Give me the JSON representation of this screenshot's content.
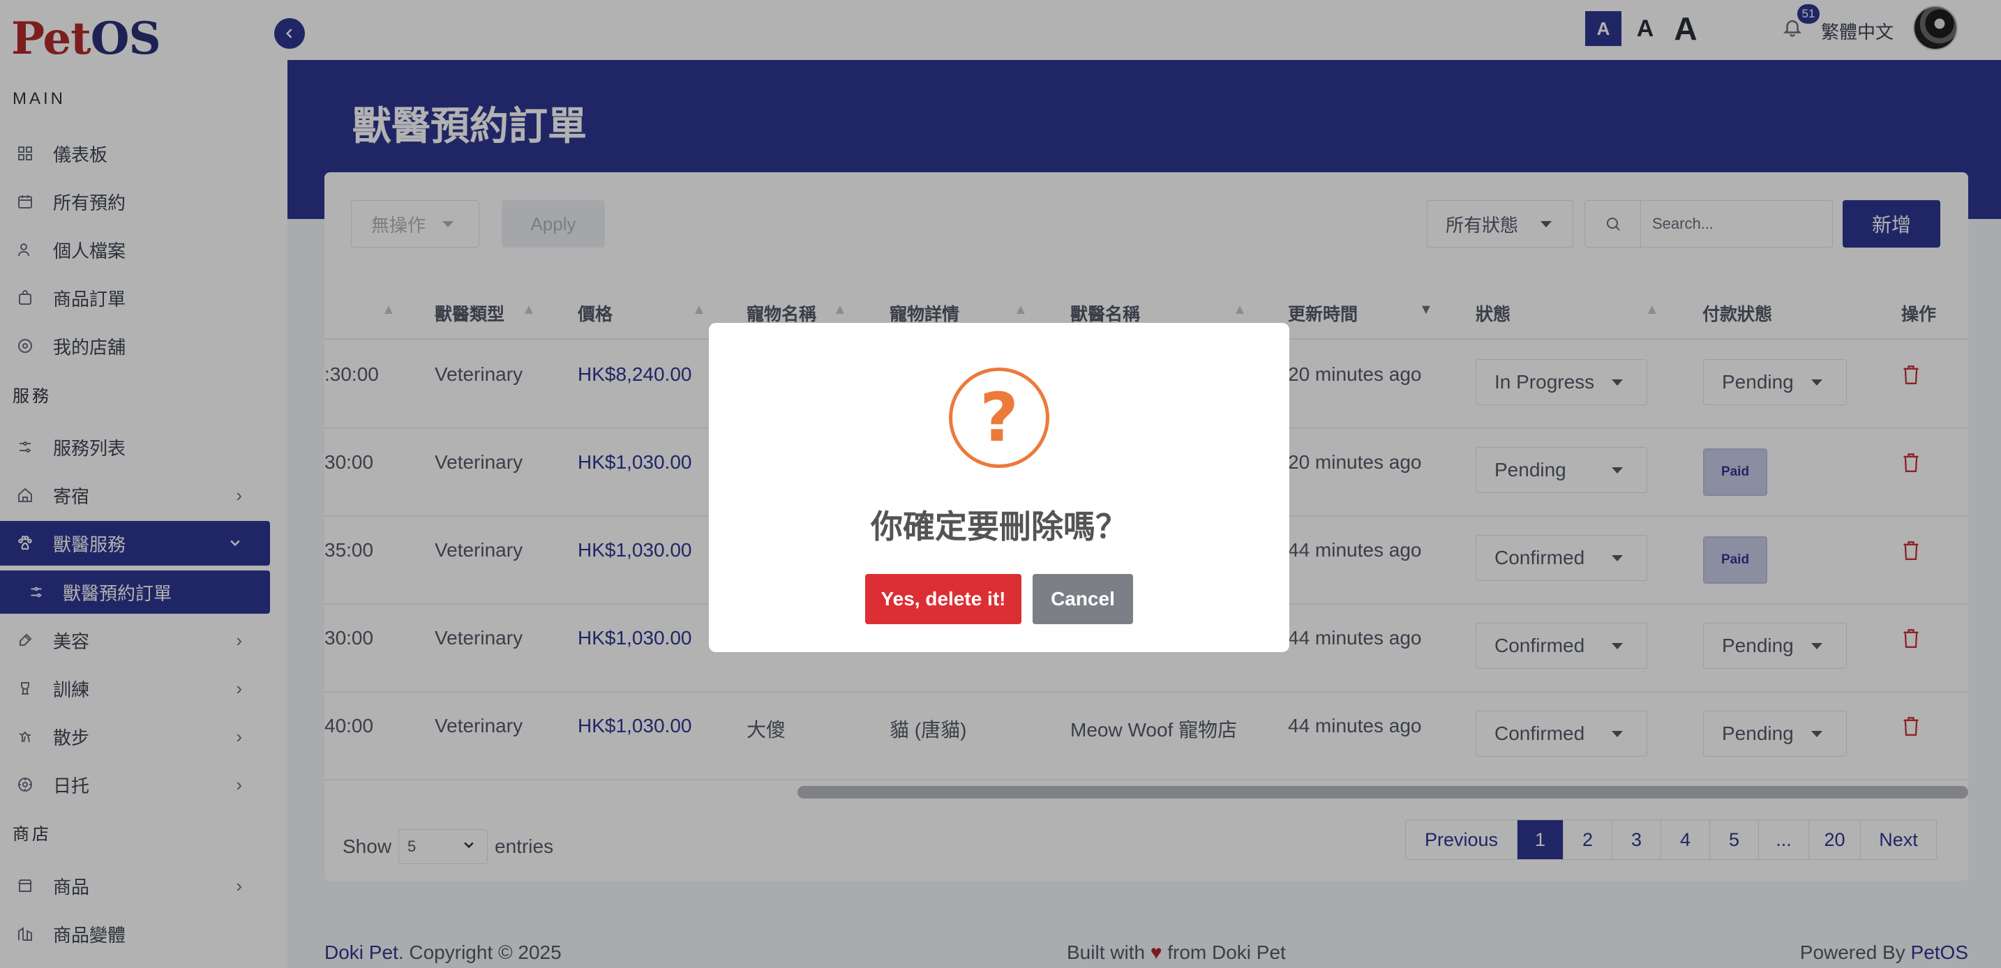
{
  "sidebar": {
    "logo": {
      "p": "P",
      "et": "et",
      "os": "OS"
    },
    "sections": {
      "main": "MAIN",
      "services": "服務",
      "shop": "商店"
    },
    "items": [
      {
        "label": "儀表板",
        "icon": "grid-icon"
      },
      {
        "label": "所有預約",
        "icon": "calendar-icon"
      },
      {
        "label": "個人檔案",
        "icon": "user-icon"
      },
      {
        "label": "商品訂單",
        "icon": "bag-icon"
      },
      {
        "label": "我的店舖",
        "icon": "store-icon"
      },
      {
        "label": "服務列表",
        "icon": "list-icon"
      },
      {
        "label": "寄宿",
        "icon": "home-icon"
      },
      {
        "label": "獸醫服務",
        "icon": "paw-icon"
      },
      {
        "label": "獸醫預約訂單",
        "icon": "list-icon"
      },
      {
        "label": "美容",
        "icon": "brush-icon"
      },
      {
        "label": "訓練",
        "icon": "training-icon"
      },
      {
        "label": "散步",
        "icon": "walk-icon"
      },
      {
        "label": "日托",
        "icon": "daycare-icon"
      },
      {
        "label": "商品",
        "icon": "shop-icon"
      },
      {
        "label": "商品變體",
        "icon": "variant-icon"
      }
    ]
  },
  "topbar": {
    "font_small": "A",
    "font_medium": "A",
    "font_large": "A",
    "notification_count": "51",
    "language": "繁體中文"
  },
  "page": {
    "title": "獸醫預約訂單"
  },
  "toolbar": {
    "bulk_action": "無操作",
    "apply": "Apply",
    "status_filter": "所有狀態",
    "search_placeholder": "Search...",
    "add": "新增"
  },
  "table": {
    "headers": [
      "獸醫類型",
      "價格",
      "寵物名稱",
      "寵物詳情",
      "獸醫名稱",
      "更新時間",
      "狀態",
      "付款狀態",
      "操作"
    ],
    "rows": [
      {
        "time": ":30:00",
        "type": "Veterinary",
        "price": "HK$8,240.00",
        "pet": "",
        "detail": "",
        "vet": "",
        "updated": "20 minutes ago",
        "status": "In Progress",
        "payment": "Pending"
      },
      {
        "time": "30:00",
        "type": "Veterinary",
        "price": "HK$1,030.00",
        "pet": "",
        "detail": "",
        "vet": "",
        "updated": "20 minutes ago",
        "status": "Pending",
        "payment": "Paid"
      },
      {
        "time": "35:00",
        "type": "Veterinary",
        "price": "HK$1,030.00",
        "pet": "",
        "detail": "",
        "vet": "",
        "updated": "44 minutes ago",
        "status": "Confirmed",
        "payment": "Paid"
      },
      {
        "time": "30:00",
        "type": "Veterinary",
        "price": "HK$1,030.00",
        "pet": "",
        "detail": "",
        "vet": "",
        "updated": "44 minutes ago",
        "status": "Confirmed",
        "payment": "Pending"
      },
      {
        "time": "40:00",
        "type": "Veterinary",
        "price": "HK$1,030.00",
        "pet": "大傻",
        "detail": "貓 (唐貓)",
        "vet": "Meow Woof 寵物店",
        "updated": "44 minutes ago",
        "status": "Confirmed",
        "payment": "Pending"
      }
    ]
  },
  "pagination": {
    "show": "Show",
    "page_size": "5",
    "entries": "entries",
    "previous": "Previous",
    "pages": [
      "1",
      "2",
      "3",
      "4",
      "5",
      "...",
      "20"
    ],
    "next": "Next",
    "current": "1"
  },
  "footer": {
    "brand": "Doki Pet",
    "copyright": ". Copyright © 2025",
    "built_prefix": "Built with",
    "heart": "♥",
    "built_suffix": "from Doki Pet",
    "powered_prefix": "Powered By",
    "powered_brand": "PetOS"
  },
  "modal": {
    "icon": "question-icon",
    "title": "你確定要刪除嗎？",
    "confirm": "Yes, delete it!",
    "cancel": "Cancel"
  },
  "colors": {
    "primary": "#2e3791",
    "danger": "#dc2f34",
    "warning": "#ec7a3a",
    "logo_red": "#b22b2b"
  }
}
